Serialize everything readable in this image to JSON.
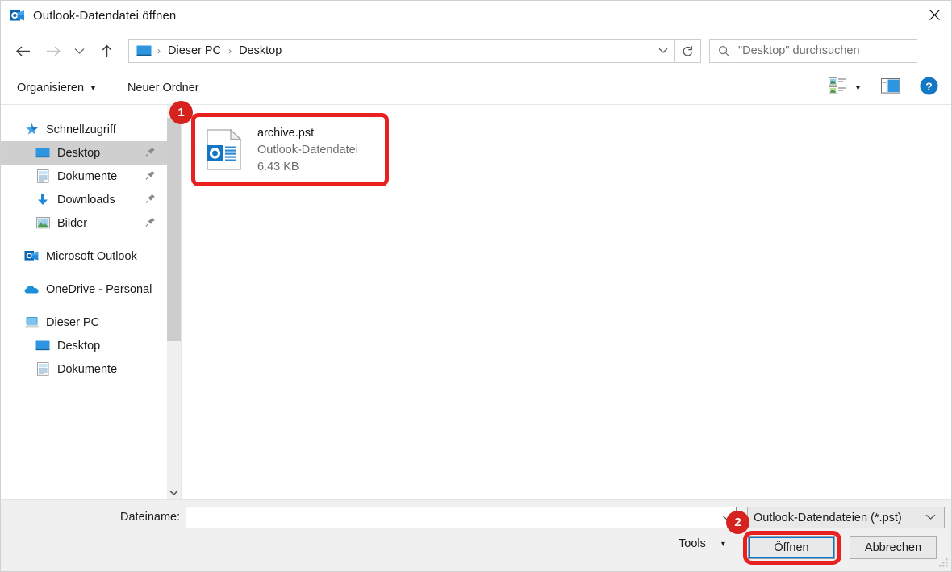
{
  "window": {
    "title": "Outlook-Datendatei öffnen",
    "title_icon": "outlook-icon",
    "close_label": "×"
  },
  "navbar": {
    "back_icon": "arrow-left-icon",
    "forward_icon": "arrow-right-icon",
    "recent_icon": "chevron-down-icon",
    "up_icon": "arrow-up-icon",
    "address": {
      "root_icon": "monitor-icon",
      "crumbs": [
        "Dieser PC",
        "Desktop"
      ],
      "separator": "›",
      "dropdown_icon": "chevron-down-icon"
    },
    "refresh_icon": "refresh-icon",
    "search": {
      "icon": "search-icon",
      "placeholder": "\"Desktop\" durchsuchen"
    }
  },
  "commandbar": {
    "organize": "Organisieren",
    "new_folder": "Neuer Ordner",
    "view_icon": "view-layout-icon",
    "view_caret": "▾",
    "preview_pane_icon": "preview-pane-icon",
    "help_icon": "help-icon"
  },
  "sidebar": {
    "items": [
      {
        "label": "Schnellzugriff",
        "icon": "quick-access-star-icon",
        "indent": 0,
        "selected": false,
        "pinned": false
      },
      {
        "label": "Desktop",
        "icon": "desktop-monitor-icon",
        "indent": 1,
        "selected": true,
        "pinned": true
      },
      {
        "label": "Dokumente",
        "icon": "documents-icon",
        "indent": 1,
        "selected": false,
        "pinned": true
      },
      {
        "label": "Downloads",
        "icon": "downloads-arrow-icon",
        "indent": 1,
        "selected": false,
        "pinned": true
      },
      {
        "label": "Bilder",
        "icon": "pictures-icon",
        "indent": 1,
        "selected": false,
        "pinned": true
      },
      {
        "label": "Microsoft Outlook",
        "icon": "outlook-icon",
        "indent": 0,
        "selected": false,
        "pinned": false
      },
      {
        "label": "OneDrive - Personal",
        "icon": "onedrive-cloud-icon",
        "indent": 0,
        "selected": false,
        "pinned": false
      },
      {
        "label": "Dieser PC",
        "icon": "this-pc-icon",
        "indent": 0,
        "selected": false,
        "pinned": false
      },
      {
        "label": "Desktop",
        "icon": "desktop-monitor-icon",
        "indent": 1,
        "selected": false,
        "pinned": false
      },
      {
        "label": "Dokumente",
        "icon": "documents-icon",
        "indent": 1,
        "selected": false,
        "pinned": false
      }
    ],
    "scrollbar_down_icon": "chevron-down-icon"
  },
  "filepane": {
    "files": [
      {
        "name": "archive.pst",
        "type": "Outlook-Datendatei",
        "size": "6.43 KB",
        "icon": "pst-file-icon",
        "selected": true
      }
    ]
  },
  "footer": {
    "filename_label": "Dateiname:",
    "filename_value": "",
    "filename_placeholder": "",
    "filename_dropdown_icon": "chevron-down-icon",
    "filetype_value": "Outlook-Datendateien (*.pst)",
    "filetype_caret": "⌄",
    "tools_label": "Tools",
    "tools_caret": "▾",
    "open_label": "Öffnen",
    "cancel_label": "Abbrechen",
    "resize_grip_icon": "resize-grip-icon"
  },
  "annotations": [
    {
      "badge": "1",
      "target": "file-item-archive-pst"
    },
    {
      "badge": "2",
      "target": "open-button"
    }
  ],
  "colors": {
    "accent_blue": "#0078d7",
    "annotation_red": "#e8201f",
    "badge_red": "#d6231f",
    "selection_gray": "#cfcfcf"
  }
}
